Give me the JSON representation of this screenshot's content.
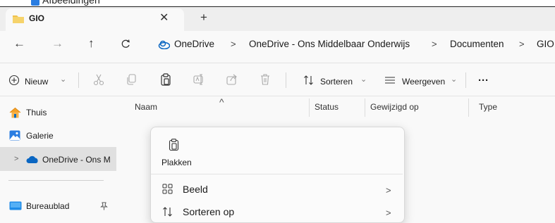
{
  "background_window": {
    "label": "Afbeeldingen"
  },
  "tab": {
    "title": "GIO",
    "close_glyph": "✕",
    "new_tab_glyph": "+"
  },
  "nav": {
    "back": "←",
    "forward": "→",
    "up": "↑",
    "refresh": "C"
  },
  "breadcrumbs": [
    "OneDrive",
    "OneDrive - Ons Middelbaar Onderwijs",
    "Documenten",
    "GIO"
  ],
  "breadcrumb_separator": ">",
  "toolbar": {
    "new_label": "Nieuw",
    "sort_label": "Sorteren",
    "view_label": "Weergeven",
    "more_label": "···",
    "dropdown_glyph": "⌄"
  },
  "columns": [
    "Naam",
    "Status",
    "Gewijzigd op",
    "Type"
  ],
  "sort_indicator": "^",
  "sidebar": {
    "items": [
      {
        "label": "Thuis",
        "icon": "home-icon"
      },
      {
        "label": "Galerie",
        "icon": "gallery-icon"
      },
      {
        "label": "OneDrive - Ons M",
        "icon": "onedrive-cloud-icon"
      },
      {
        "label": "Bureaublad",
        "icon": "desktop-icon"
      }
    ],
    "expand_glyph": ">",
    "pin_glyph": "📌"
  },
  "context_menu": {
    "paste_label": "Plakken",
    "items": [
      {
        "label": "Beeld",
        "icon": "view-grid-icon"
      },
      {
        "label": "Sorteren op",
        "icon": "sort-icon"
      }
    ],
    "chevron": ">"
  },
  "colors": {
    "accent": "#0f6cbd",
    "folder": "#f0c14b",
    "onedrive": "#0a66c2"
  }
}
